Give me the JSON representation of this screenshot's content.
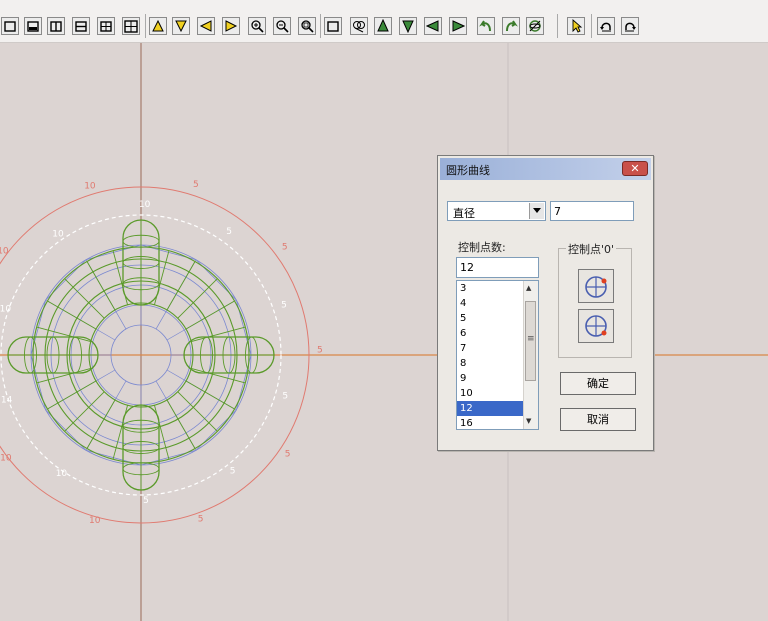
{
  "toolbar": {
    "buttons": [
      {
        "name": "single-view-button",
        "icon": "single-view-icon"
      },
      {
        "name": "split-bottom-button",
        "icon": "split-bottom-icon"
      },
      {
        "name": "split-vertical-button",
        "icon": "split-vertical-icon"
      },
      {
        "name": "split-horizontal-button",
        "icon": "split-horizontal-icon"
      },
      {
        "name": "quad-view-button",
        "icon": "quad-view-icon"
      },
      {
        "name": "quad-view-alt-button",
        "icon": "quad-view-alt-icon"
      },
      {
        "name": "view-top-button",
        "icon": "triangle-up-icon"
      },
      {
        "name": "view-bottom-button",
        "icon": "triangle-down-icon"
      },
      {
        "name": "view-left-button",
        "icon": "triangle-left-icon"
      },
      {
        "name": "view-right-button",
        "icon": "triangle-right-icon"
      },
      {
        "name": "zoom-in-button",
        "icon": "zoom-in-icon"
      },
      {
        "name": "zoom-out-button",
        "icon": "zoom-out-icon"
      },
      {
        "name": "zoom-window-button",
        "icon": "zoom-window-icon"
      },
      {
        "name": "zoom-extents-button",
        "icon": "zoom-extents-icon"
      },
      {
        "name": "zoom-all-button",
        "icon": "zoom-all-icon"
      },
      {
        "name": "pan-up-button",
        "icon": "arrow-up-icon"
      },
      {
        "name": "pan-down-button",
        "icon": "arrow-down-icon"
      },
      {
        "name": "pan-left-button",
        "icon": "arrow-left-icon"
      },
      {
        "name": "pan-right-button",
        "icon": "arrow-right-icon"
      },
      {
        "name": "rotate-left-button",
        "icon": "rotate-left-icon"
      },
      {
        "name": "rotate-right-button",
        "icon": "rotate-right-icon"
      },
      {
        "name": "orbit-button",
        "icon": "orbit-icon"
      },
      {
        "name": "select-pointer-button",
        "icon": "pointer-icon"
      },
      {
        "name": "undo-button",
        "icon": "undo-icon"
      },
      {
        "name": "redo-button",
        "icon": "redo-icon"
      }
    ]
  },
  "colors": {
    "canvas_bg": "#dcd4d2",
    "axis_vertical": "#9a6a58",
    "axis_horizontal": "#d9864a",
    "circle_outer": "#e07a70",
    "circle_dashed": "#ffffff",
    "mesh_green": "#5a9a2a",
    "mesh_blue": "#7a88d0",
    "accent_dialog": "#3a68c8"
  },
  "canvas": {
    "dimension_labels": [
      "5",
      "5",
      "5",
      "5",
      "5",
      "5",
      "5",
      "5",
      "5",
      "5",
      "10",
      "10",
      "10",
      "14",
      "10",
      "10",
      "10",
      "10",
      "10",
      "10"
    ]
  },
  "dialog": {
    "title": "圆形曲线",
    "close_glyph": "✕",
    "mode_select": {
      "value": "直径"
    },
    "diameter_input": {
      "value": "7"
    },
    "control_points_label": "控制点数:",
    "control_points_value": "12",
    "control_point_group_label": "控制点'0'",
    "list_items": [
      "3",
      "4",
      "5",
      "6",
      "7",
      "8",
      "9",
      "10",
      "12",
      "16"
    ],
    "selected_item": "12",
    "scroll_mid_glyph": "≡",
    "ok_label": "确定",
    "cancel_label": "取消"
  }
}
